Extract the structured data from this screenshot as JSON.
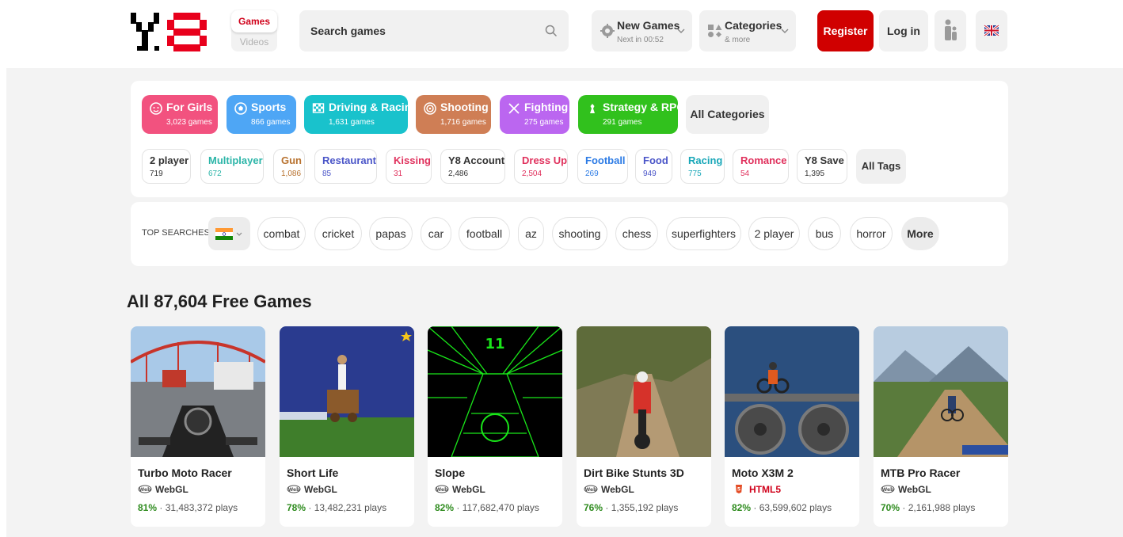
{
  "header": {
    "toggle": {
      "games": "Games",
      "videos": "Videos"
    },
    "search": {
      "placeholder": "Search games"
    },
    "new_games": {
      "label": "New Games",
      "sub": "Next in 00:52"
    },
    "categories": {
      "label": "Categories",
      "sub": "& more"
    },
    "register": "Register",
    "login": "Log in"
  },
  "colors": {
    "brand_red": "#d00000",
    "girls": "#f2527f",
    "sports": "#4ea6f5",
    "driving": "#19c2cc",
    "shooting": "#cf7e55",
    "fighting": "#bb66f0",
    "strategy": "#31c11d"
  },
  "categories": [
    {
      "name": "For Girls",
      "count": "3,023 games",
      "icon": "baby-face-icon"
    },
    {
      "name": "Sports",
      "count": "866 games",
      "icon": "ball-icon"
    },
    {
      "name": "Driving & Racing",
      "count": "1,631 games",
      "icon": "checkered-flag-icon"
    },
    {
      "name": "Shooting",
      "count": "1,716 games",
      "icon": "target-icon"
    },
    {
      "name": "Fighting",
      "count": "275 games",
      "icon": "crossed-swords-icon"
    },
    {
      "name": "Strategy & RPG",
      "count": "291 games",
      "icon": "chess-piece-icon"
    }
  ],
  "all_categories": "All Categories",
  "tags": [
    {
      "name": "2 player",
      "count": "719",
      "color": "#333333"
    },
    {
      "name": "Multiplayer",
      "count": "672",
      "color": "#2bb5a8"
    },
    {
      "name": "Gun",
      "count": "1,086",
      "color": "#b8722f"
    },
    {
      "name": "Restaurant",
      "count": "85",
      "color": "#4a55c8"
    },
    {
      "name": "Kissing",
      "count": "31",
      "color": "#e0305c"
    },
    {
      "name": "Y8 Account",
      "count": "2,486",
      "color": "#333333"
    },
    {
      "name": "Dress Up",
      "count": "2,504",
      "color": "#e0305c"
    },
    {
      "name": "Football",
      "count": "269",
      "color": "#2c7be5"
    },
    {
      "name": "Food",
      "count": "949",
      "color": "#4a55c8"
    },
    {
      "name": "Racing",
      "count": "775",
      "color": "#19a7b8"
    },
    {
      "name": "Romance",
      "count": "54",
      "color": "#e0305c"
    },
    {
      "name": "Y8 Save",
      "count": "1,395",
      "color": "#333333"
    }
  ],
  "all_tags": "All Tags",
  "top_searches": {
    "label": "TOP SEARCHES",
    "items": [
      "combat",
      "cricket",
      "papas",
      "car",
      "football",
      "az",
      "shooting",
      "chess",
      "superfighters",
      "2 player",
      "bus",
      "horror"
    ],
    "more": "More"
  },
  "section_title": "All 87,604 Free Games",
  "games": [
    {
      "name": "Turbo Moto Racer",
      "tech": "WebGL",
      "rating": "81%",
      "plays": "31,483,372 plays"
    },
    {
      "name": "Short Life",
      "tech": "WebGL",
      "rating": "78%",
      "plays": "13,482,231 plays"
    },
    {
      "name": "Slope",
      "tech": "WebGL",
      "rating": "82%",
      "plays": "117,682,470 plays"
    },
    {
      "name": "Dirt Bike Stunts 3D",
      "tech": "WebGL",
      "rating": "76%",
      "plays": "1,355,192 plays"
    },
    {
      "name": "Moto X3M 2",
      "tech": "HTML5",
      "rating": "82%",
      "plays": "63,599,602 plays"
    },
    {
      "name": "MTB Pro Racer",
      "tech": "WebGL",
      "rating": "70%",
      "plays": "2,161,988 plays"
    }
  ]
}
